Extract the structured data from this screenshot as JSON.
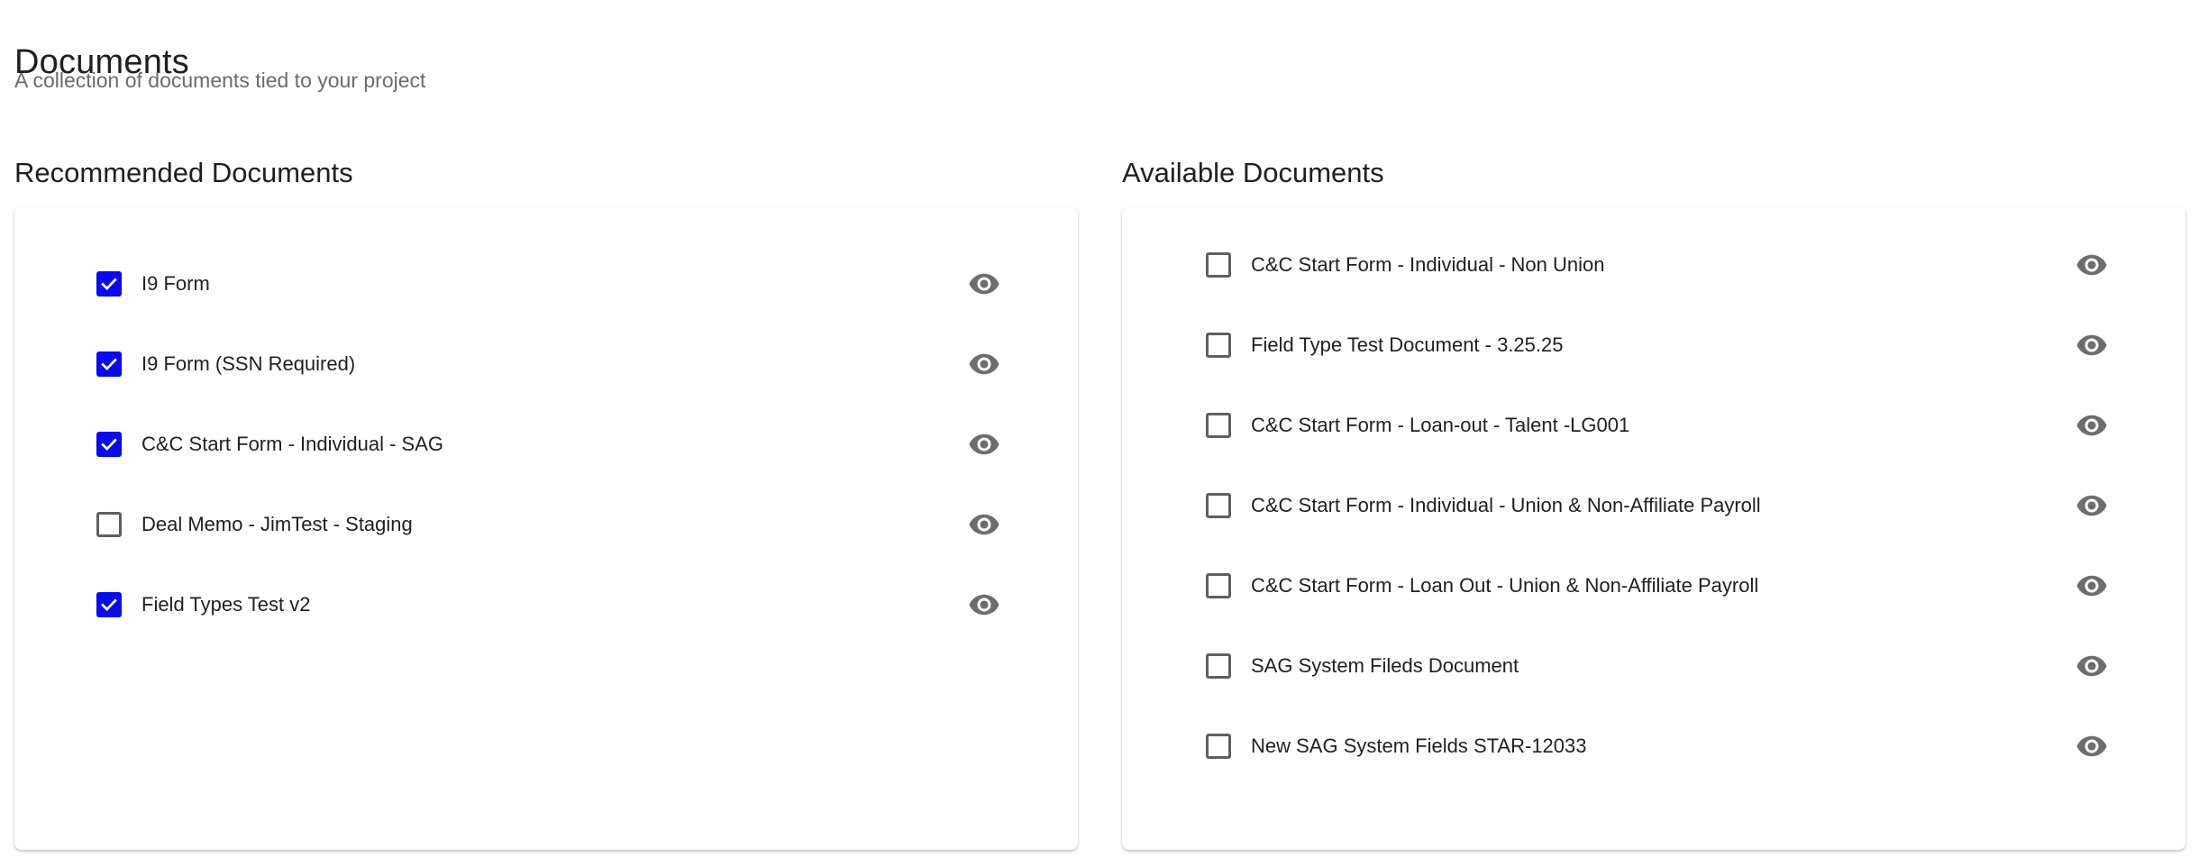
{
  "header": {
    "title": "Documents",
    "subtitle": "A collection of documents tied to your project"
  },
  "recommended": {
    "title": "Recommended Documents",
    "items": [
      {
        "label": "I9 Form",
        "checked": true
      },
      {
        "label": "I9 Form (SSN Required)",
        "checked": true
      },
      {
        "label": "C&C Start Form - Individual - SAG",
        "checked": true
      },
      {
        "label": "Deal Memo - JimTest - Staging",
        "checked": false
      },
      {
        "label": "Field Types Test v2",
        "checked": true
      }
    ]
  },
  "available": {
    "title": "Available Documents",
    "items": [
      {
        "label": "C&C Start Form - Individual - Non Union",
        "checked": false
      },
      {
        "label": "Field Type Test Document - 3.25.25",
        "checked": false
      },
      {
        "label": "C&C Start Form - Loan-out - Talent -LG001",
        "checked": false
      },
      {
        "label": "C&C Start Form - Individual - Union & Non-Affiliate Payroll",
        "checked": false
      },
      {
        "label": "C&C Start Form - Loan Out - Union & Non-Affiliate Payroll",
        "checked": false
      },
      {
        "label": "SAG System Fileds Document",
        "checked": false
      },
      {
        "label": "New SAG System Fields STAR-12033",
        "checked": false
      }
    ]
  },
  "icons": {
    "view": "eye-icon",
    "check": "check-icon"
  },
  "colors": {
    "checkbox_checked": "#0a0aee",
    "checkbox_unchecked_border": "#5f5f5f",
    "icon_gray": "#6d6d6d",
    "subtitle": "#6b6b6b"
  }
}
